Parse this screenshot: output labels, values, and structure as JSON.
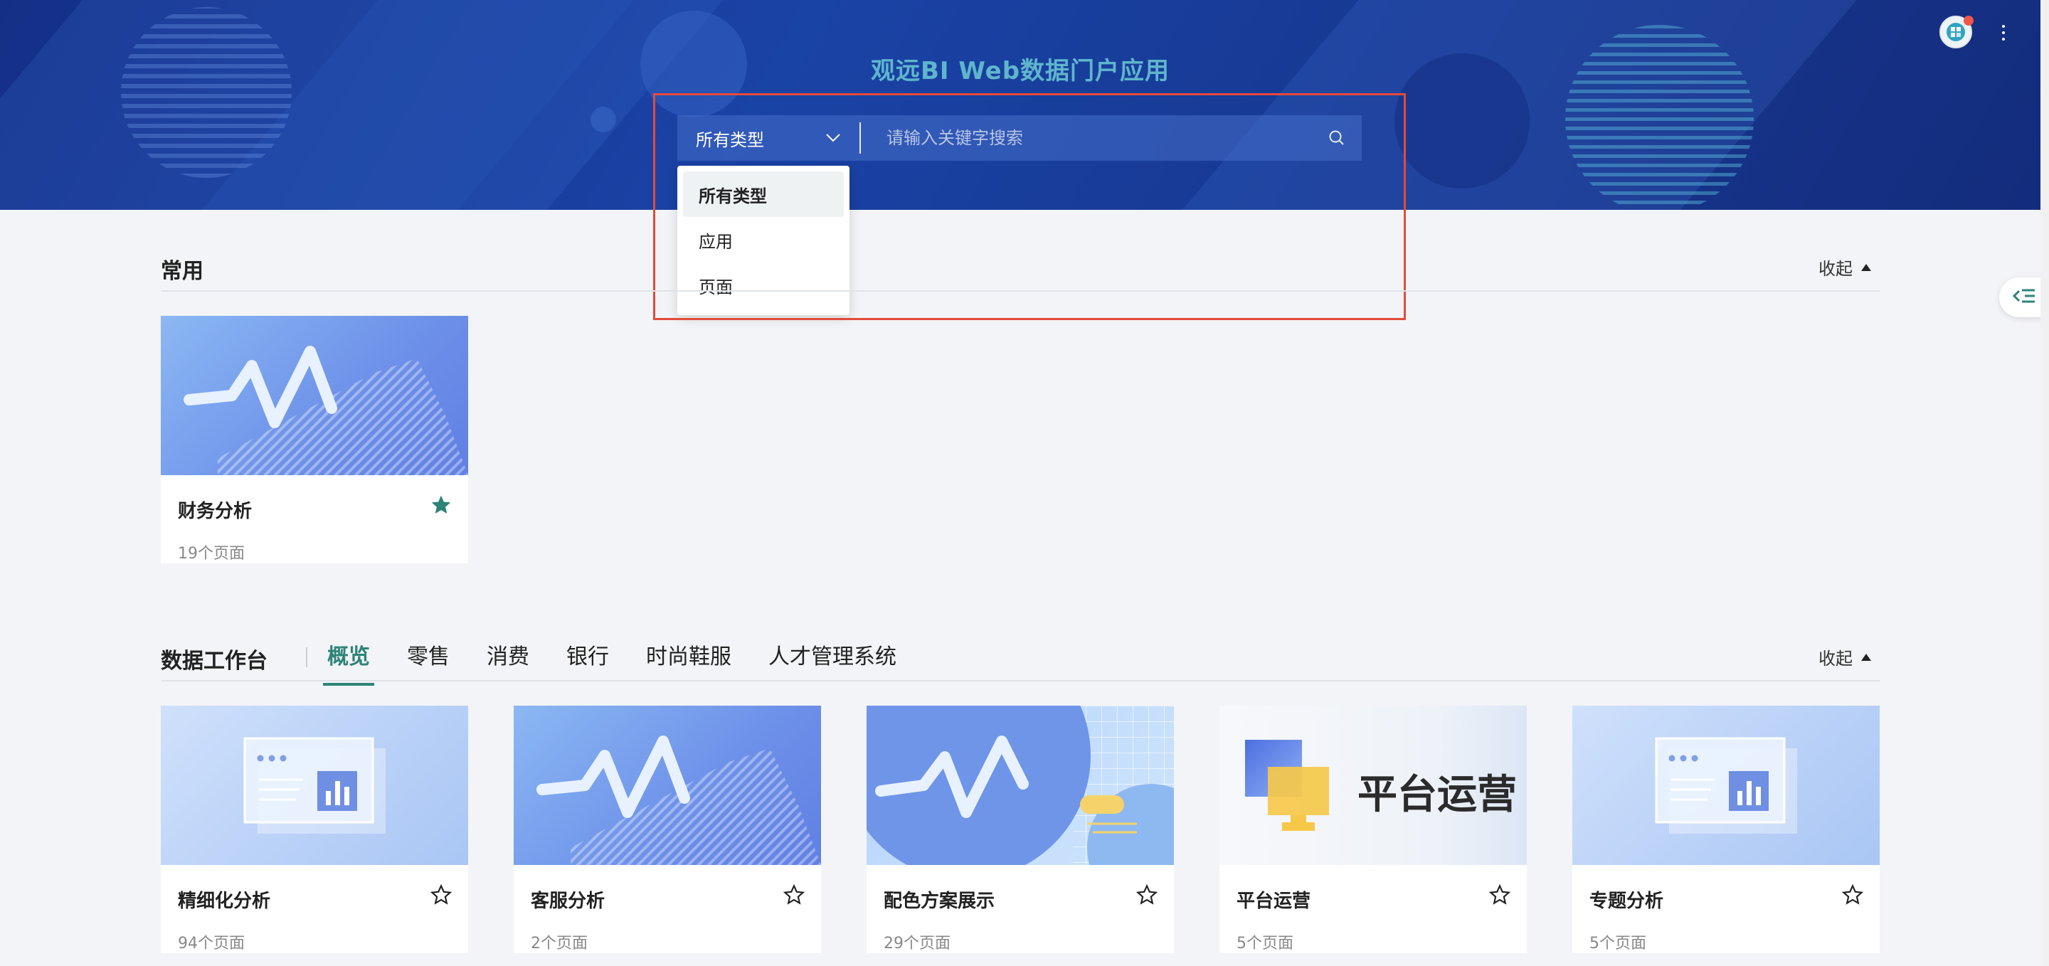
{
  "banner": {
    "title": "观远BI Web数据门户应用"
  },
  "search": {
    "type_selected": "所有类型",
    "placeholder": "请输入关键字搜索",
    "type_options": [
      "所有类型",
      "应用",
      "页面"
    ]
  },
  "common": {
    "title": "常用",
    "collapse_label": "收起",
    "cards": [
      {
        "title": "财务分析",
        "subtitle": "19个页面",
        "starred": true
      }
    ]
  },
  "workbench": {
    "title": "数据工作台",
    "collapse_label": "收起",
    "tabs": [
      "概览",
      "零售",
      "消费",
      "银行",
      "时尚鞋服",
      "人才管理系统"
    ],
    "active_tab": "概览",
    "cards": [
      {
        "title": "精细化分析",
        "subtitle": "94个页面",
        "starred": false
      },
      {
        "title": "客服分析",
        "subtitle": "2个页面",
        "starred": false
      },
      {
        "title": "配色方案展示",
        "subtitle": "29个页面",
        "starred": false
      },
      {
        "title": "平台运营",
        "subtitle": "5个页面",
        "starred": false,
        "thumb_text": "平台运营"
      },
      {
        "title": "专题分析",
        "subtitle": "5个页面",
        "starred": false
      }
    ]
  },
  "colors": {
    "accent": "#2e8378",
    "highlight": "#e34b3a",
    "banner": "#1a43a6"
  }
}
